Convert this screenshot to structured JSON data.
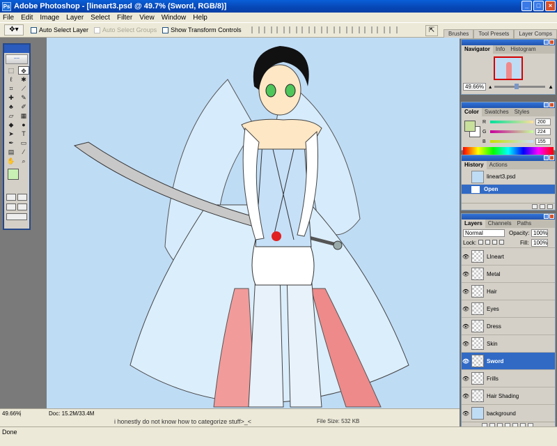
{
  "window": {
    "title": "Adobe Photoshop - [lineart3.psd @ 49.7% (Sword, RGB/8)]"
  },
  "menu": [
    "File",
    "Edit",
    "Image",
    "Layer",
    "Select",
    "Filter",
    "View",
    "Window",
    "Help"
  ],
  "options": {
    "auto_select_layer": "Auto Select Layer",
    "auto_select_groups": "Auto Select Groups",
    "show_transform": "Show Transform Controls"
  },
  "palette_well": {
    "tabs": [
      "Brushes",
      "Tool Presets",
      "Layer Comps"
    ]
  },
  "navigator": {
    "tabs": [
      "Navigator",
      "Info",
      "Histogram"
    ],
    "zoom": "49.66%"
  },
  "color": {
    "tabs": [
      "Color",
      "Swatches",
      "Styles"
    ],
    "r_label": "R",
    "g_label": "G",
    "b_label": "B",
    "r": "200",
    "g": "224",
    "b": "155",
    "fg_hex": "#c8e09b"
  },
  "history": {
    "tabs": [
      "History",
      "Actions"
    ],
    "snapshot": "lineart3.psd",
    "state": "Open"
  },
  "layers": {
    "tabs": [
      "Layers",
      "Channels",
      "Paths"
    ],
    "blend_mode": "Normal",
    "opacity_label": "Opacity:",
    "opacity": "100%",
    "lock_label": "Lock:",
    "fill_label": "Fill:",
    "fill": "100%",
    "items": [
      {
        "name": "LIneart"
      },
      {
        "name": "Metal"
      },
      {
        "name": "Hair"
      },
      {
        "name": "Eyes"
      },
      {
        "name": "Dress"
      },
      {
        "name": "Skin"
      },
      {
        "name": "Sword"
      },
      {
        "name": "Frills"
      },
      {
        "name": "Hair Shading"
      },
      {
        "name": "background"
      }
    ]
  },
  "docstatus": {
    "zoom": "49.66%",
    "doc_size": "Doc: 15.2M/33.4M"
  },
  "caption": {
    "text": "i honestly do not know how to categorize stuff>_<",
    "file_size": "File Size: 532 KB"
  },
  "statusbar": {
    "text": "Done"
  }
}
